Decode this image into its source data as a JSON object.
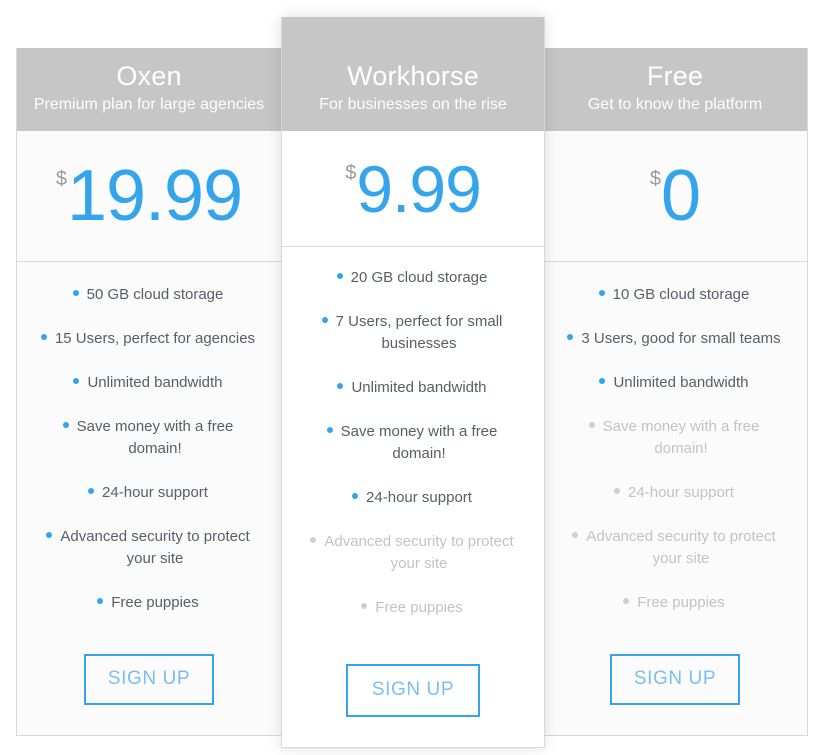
{
  "page": {
    "title": "Pricing Table",
    "accent_color": "#34a4ec",
    "header_bg_color": "#c6c6c6",
    "disabled_text_color": "#c3c3c3"
  },
  "plans": [
    {
      "id": "oxen",
      "name": "Oxen",
      "tagline": "Premium plan for large agencies",
      "currency": "$",
      "price": "19.99",
      "featured": false,
      "cta_label": "SIGN UP",
      "features": [
        {
          "label": "50 GB cloud storage",
          "enabled": true
        },
        {
          "label": "15 Users, perfect for agencies",
          "enabled": true
        },
        {
          "label": "Unlimited bandwidth",
          "enabled": true
        },
        {
          "label": "Save money with a free domain!",
          "enabled": true
        },
        {
          "label": "24-hour support",
          "enabled": true
        },
        {
          "label": "Advanced security to protect your site",
          "enabled": true
        },
        {
          "label": "Free puppies",
          "enabled": true
        }
      ]
    },
    {
      "id": "workhorse",
      "name": "Workhorse",
      "tagline": "For businesses on the rise",
      "currency": "$",
      "price": "9.99",
      "featured": true,
      "cta_label": "SIGN UP",
      "features": [
        {
          "label": "20 GB cloud storage",
          "enabled": true
        },
        {
          "label": "7 Users, perfect for small businesses",
          "enabled": true
        },
        {
          "label": "Unlimited bandwidth",
          "enabled": true
        },
        {
          "label": "Save money with a free domain!",
          "enabled": true
        },
        {
          "label": "24-hour support",
          "enabled": true
        },
        {
          "label": "Advanced security to protect your site",
          "enabled": false
        },
        {
          "label": "Free puppies",
          "enabled": false
        }
      ]
    },
    {
      "id": "free",
      "name": "Free",
      "tagline": "Get to know the platform",
      "currency": "$",
      "price": "0",
      "featured": false,
      "cta_label": "SIGN UP",
      "features": [
        {
          "label": "10 GB cloud storage",
          "enabled": true
        },
        {
          "label": "3 Users, good for small teams",
          "enabled": true
        },
        {
          "label": "Unlimited bandwidth",
          "enabled": true
        },
        {
          "label": "Save money with a free domain!",
          "enabled": false
        },
        {
          "label": "24-hour support",
          "enabled": false
        },
        {
          "label": "Advanced security to protect your site",
          "enabled": false
        },
        {
          "label": "Free puppies",
          "enabled": false
        }
      ]
    }
  ]
}
